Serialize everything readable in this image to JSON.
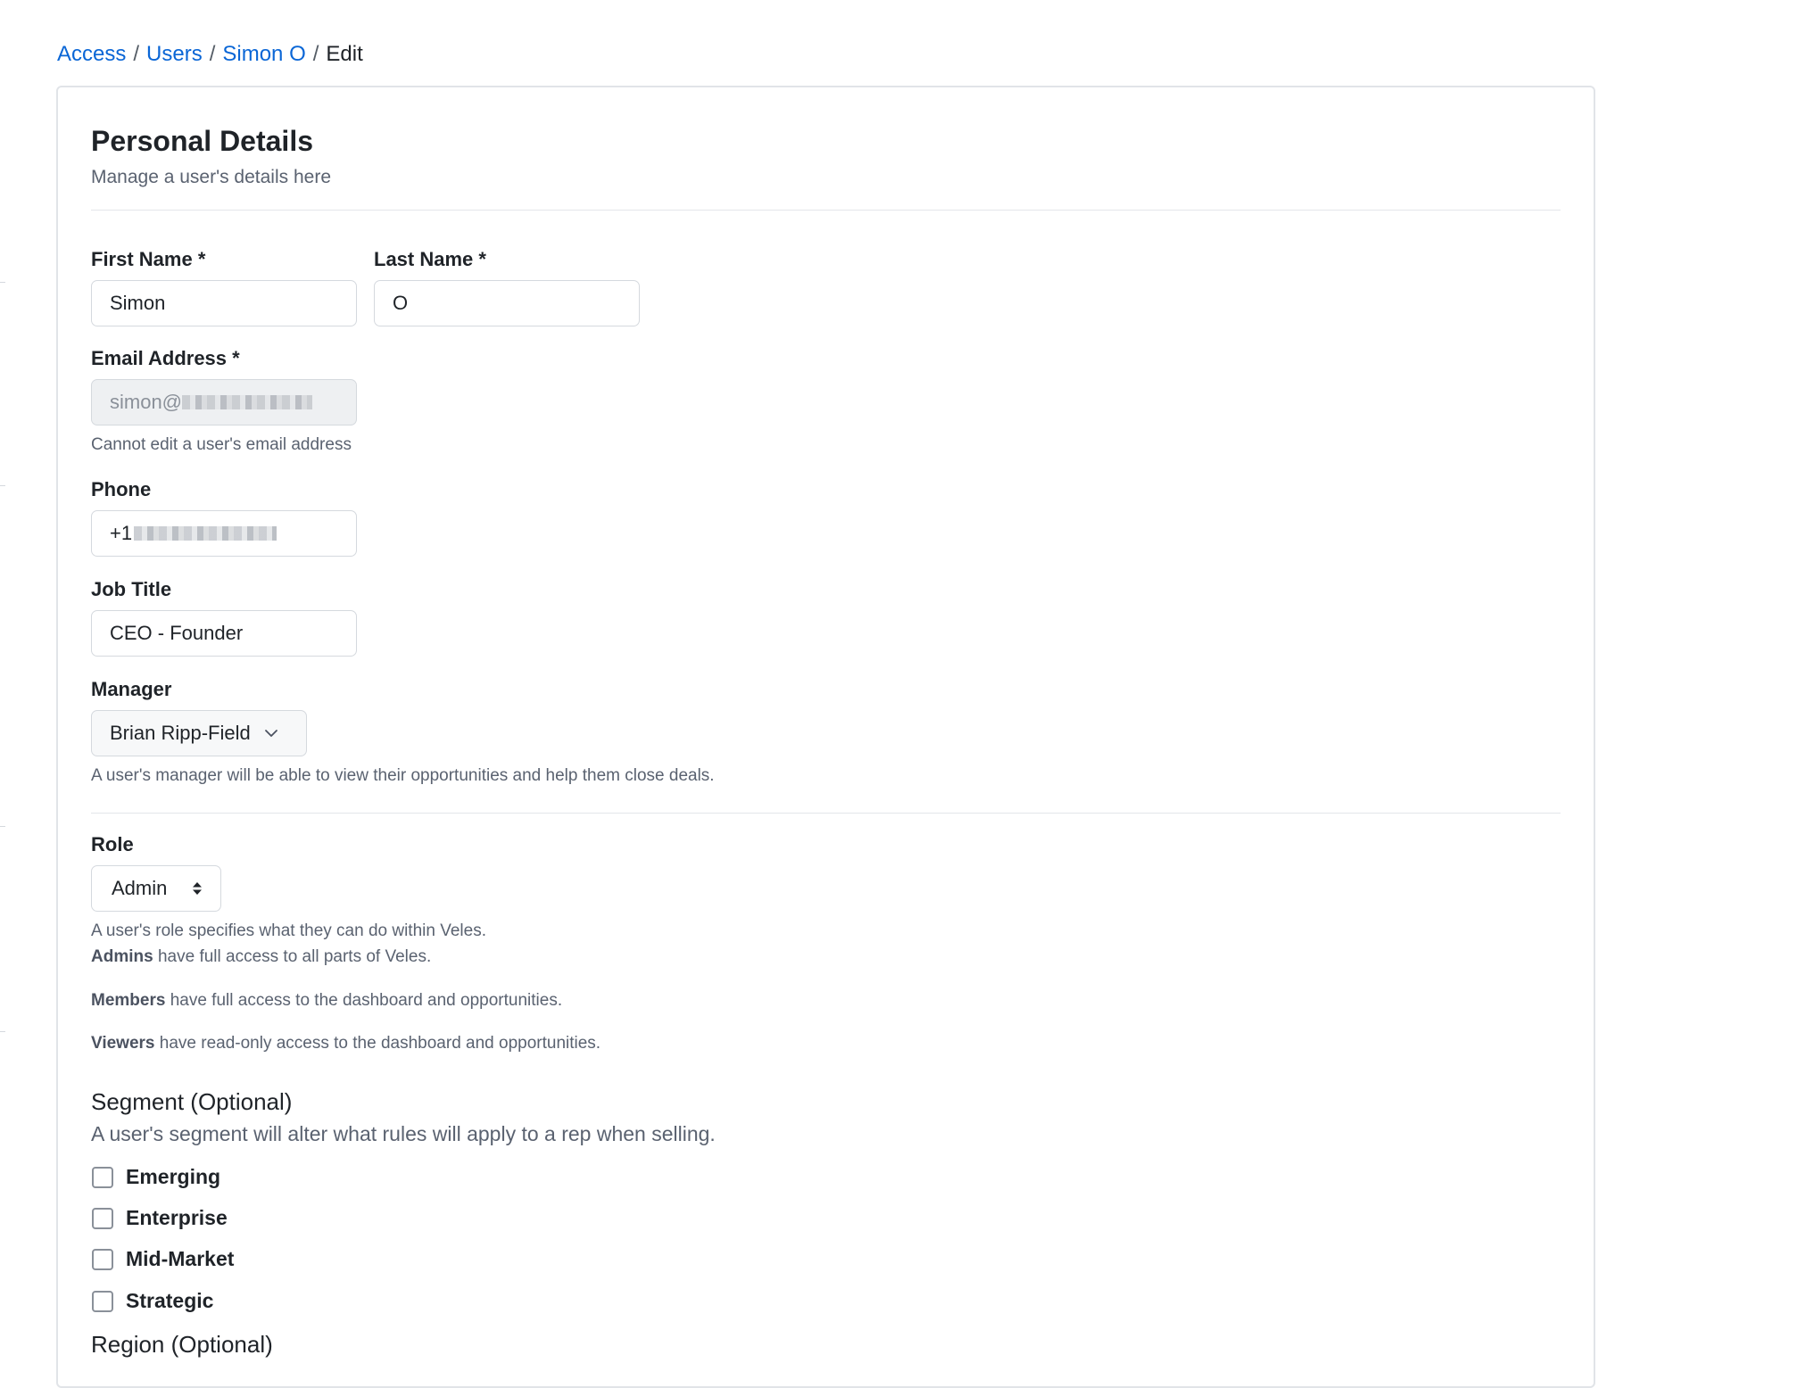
{
  "breadcrumb": {
    "items": [
      "Access",
      "Users",
      "Simon O"
    ],
    "current": "Edit",
    "separator": "/"
  },
  "header": {
    "title": "Personal Details",
    "subtitle": "Manage a user's details here"
  },
  "form": {
    "first_name": {
      "label": "First Name *",
      "value": "Simon"
    },
    "last_name": {
      "label": "Last Name *",
      "value": "O"
    },
    "email": {
      "label": "Email Address *",
      "value_visible": "simon@",
      "help": "Cannot edit a user's email address"
    },
    "phone": {
      "label": "Phone",
      "value_visible": "+1"
    },
    "job_title": {
      "label": "Job Title",
      "value": "CEO - Founder"
    },
    "manager": {
      "label": "Manager",
      "selected": "Brian Ripp-Field",
      "help": "A user's manager will be able to view their opportunities and help them close deals."
    },
    "role": {
      "label": "Role",
      "selected": "Admin",
      "help_intro": "A user's role specifies what they can do within Veles.",
      "admins_term": "Admins",
      "admins_desc": " have full access to all parts of Veles.",
      "members_term": "Members",
      "members_desc": " have full access to the dashboard and opportunities.",
      "viewers_term": "Viewers",
      "viewers_desc": " have read-only access to the dashboard and opportunities."
    },
    "segment": {
      "title": "Segment (Optional)",
      "subtitle": "A user's segment will alter what rules will apply to a rep when selling.",
      "options": [
        {
          "label": "Emerging",
          "checked": false
        },
        {
          "label": "Enterprise",
          "checked": false
        },
        {
          "label": "Mid-Market",
          "checked": false
        },
        {
          "label": "Strategic",
          "checked": false
        }
      ]
    },
    "region": {
      "title": "Region (Optional)"
    }
  },
  "colors": {
    "link": "#0a66d6",
    "text": "#1f2328",
    "muted": "#5a6270",
    "border": "#d5d9de"
  }
}
